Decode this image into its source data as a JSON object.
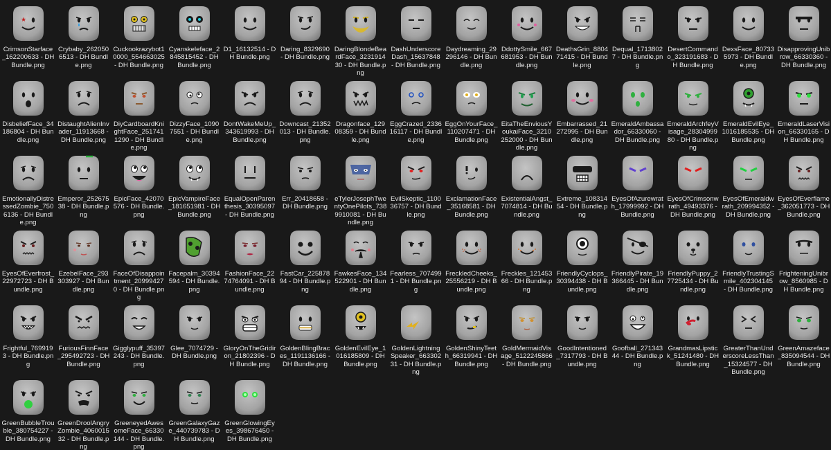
{
  "files": [
    {
      "name": "CrimsonStarface_162200633 - DH Bundle.png",
      "face": "starface"
    },
    {
      "name": "Crybaby_2620506513 - DH Bundle.png",
      "face": "crybaby"
    },
    {
      "name": "Cuckookrazybot10000_554663025 - DH Bundle.png",
      "face": "robot"
    },
    {
      "name": "Cyanskeleface_2845815452 - DH Bundle.png",
      "face": "skeleton"
    },
    {
      "name": "D1_16132514 - DH Bundle.png",
      "face": "smile"
    },
    {
      "name": "Daring_8329690 - DH Bundle.png",
      "face": "smirk"
    },
    {
      "name": "DaringBlondeBeardFace_323191430 - DH Bundle.png",
      "face": "beard"
    },
    {
      "name": "DashUnderscoreDash_15637848 - DH Bundle.png",
      "face": "dash"
    },
    {
      "name": "Daydreaming_29296146 - DH Bundle.png",
      "face": "daydream"
    },
    {
      "name": "DdottySmile_667681953 - DH Bundle.png",
      "face": "dotty"
    },
    {
      "name": "DeathsGrin_880471415 - DH Bundle.png",
      "face": "grin"
    },
    {
      "name": "Dequal_17138027 - DH Bundle.png",
      "face": "dequal"
    },
    {
      "name": "DesertCommando_323191683 - DH Bundle.png",
      "face": "commando"
    },
    {
      "name": "DexsFace_807335973 - DH Bundle.png",
      "face": "smile"
    },
    {
      "name": "DisapprovingUnibrow_66330360 - DH Bundle.png",
      "face": "unibrow"
    },
    {
      "name": "DisbeliefFace_34186804 - DH Bundle.png",
      "face": "shock"
    },
    {
      "name": "DistaughtAlienInvader_11913668 - DH Bundle.png",
      "face": "frown"
    },
    {
      "name": "DiyCardboardKnightFace_2517411290 - DH Bundle.png",
      "face": "knight"
    },
    {
      "name": "DizzyFace_10907551 - DH Bundle.png",
      "face": "dizzy"
    },
    {
      "name": "DontWakeMeUp_343619993 - DH Bundle.png",
      "face": "angry"
    },
    {
      "name": "Downcast_21352013 - DH Bundle.png",
      "face": "frown"
    },
    {
      "name": "Dragonface_12908359 - DH Bundle.png",
      "face": "dragon"
    },
    {
      "name": "EggCrazed_233616117 - DH Bundle.png",
      "face": "crazed"
    },
    {
      "name": "EggOnYourFace_110207471 - DH Bundle.png",
      "face": "egg"
    },
    {
      "name": "EitaTheEnviousYoukaiFace_3210252000 - DH Bundle.png",
      "face": "youkai"
    },
    {
      "name": "Embarrassed_21272995 - DH Bundle.png",
      "face": "blush"
    },
    {
      "name": "EmeraldAmbassador_66330060 - DH Bundle.png",
      "face": "emerald"
    },
    {
      "name": "EmeraldArchfeyVisage_2830499980 - DH Bundle.png",
      "face": "archfey"
    },
    {
      "name": "EmeraldEvilEye_1016185535 - DH Bundle.png",
      "face": "evileye"
    },
    {
      "name": "EmeraldLaserVision_66330165 - DH Bundle.png",
      "face": "laser"
    },
    {
      "name": "EmotionallyDistressedZombie_7506136 - DH Bundle.png",
      "face": "frown"
    },
    {
      "name": "Emperor_25267538 - DH Bundle.png",
      "face": "emperor"
    },
    {
      "name": "EpicFace_42070576 - DH Bundle.png",
      "face": "epic"
    },
    {
      "name": "EpicVampireFace_181651981 - DH Bundle.png",
      "face": "epicvamp"
    },
    {
      "name": "EqualOpenParenthesis_30395097 - DH Bundle.png",
      "face": "equal"
    },
    {
      "name": "Err_20418658 - DH Bundle.png",
      "face": "err"
    },
    {
      "name": "eTylerJosephTwentyOnePilots_7389910081 - DH Bundle.png",
      "face": "tyler"
    },
    {
      "name": "EvilSkeptic_110036757 - DH Bundle.png",
      "face": "evilred"
    },
    {
      "name": "ExclamationFace_35168581 - DH Bundle.png",
      "face": "exclaim"
    },
    {
      "name": "ExistentialAngst_7074814 - DH Bundle.png",
      "face": "angst"
    },
    {
      "name": "Extreme_10831454 - DH Bundle.png",
      "face": "extreme"
    },
    {
      "name": "EyesOfAzurewrath_17999992 - DH Bundle.png",
      "face": "eyespurple"
    },
    {
      "name": "EyesOfCrimsonwrath_49493376 - DH Bundle.png",
      "face": "eyesred"
    },
    {
      "name": "EyesOfEmeraldwrath_209994352 - DH Bundle.png",
      "face": "eyesgreen"
    },
    {
      "name": "EyesOfEverflame_362051773 - DH Bundle.png",
      "face": "everflame"
    },
    {
      "name": "EyesOfEverfrost_22972723 - DH Bundle.png",
      "face": "everflame"
    },
    {
      "name": "EzebelFace_293303927 - DH Bundle.png",
      "face": "ezebel"
    },
    {
      "name": "FaceOfDisappointment_209994270 - DH Bundle.png",
      "face": "frown"
    },
    {
      "name": "Facepalm_30394594 - DH Bundle.png",
      "face": "facepalm"
    },
    {
      "name": "FashionFace_2274764091 - DH Bundle.png",
      "face": "fashion"
    },
    {
      "name": "FastCar_22587894 - DH Bundle.png",
      "face": "fastcar"
    },
    {
      "name": "FawkesFace_134522901 - DH Bundle.png",
      "face": "fawkes"
    },
    {
      "name": "Fearless_7074991 - DH Bundle.png",
      "face": "fearless"
    },
    {
      "name": "FreckledCheeks_25556219 - DH Bundle.png",
      "face": "freckled"
    },
    {
      "name": "Freckles_12145366 - DH Bundle.png",
      "face": "freckles"
    },
    {
      "name": "FriendlyCyclops_30394438 - DH Bundle.png",
      "face": "cyclops"
    },
    {
      "name": "FriendlyPirate_19366445 - DH Bundle.png",
      "face": "pirate"
    },
    {
      "name": "FriendlyPuppy_27725434 - DH Bundle.png",
      "face": "puppy"
    },
    {
      "name": "FriendlyTrustingSmile_402304145 - DH Bundle.png",
      "face": "trusting"
    },
    {
      "name": "FrighteningUnibrow_8560985 - DH Bundle.png",
      "face": "frightunibrow"
    },
    {
      "name": "Frightful_7699193 - DH Bundle.png",
      "face": "frightful"
    },
    {
      "name": "FuriousFinnFace_295492723 - DH Bundle.png",
      "face": "furious"
    },
    {
      "name": "Gigglypuff_35397243 - DH Bundle.png",
      "face": "giggly"
    },
    {
      "name": "Glee_7074729 - DH Bundle.png",
      "face": "glee"
    },
    {
      "name": "GloryOnTheGridiron_21802396 - DH Bundle.png",
      "face": "glory"
    },
    {
      "name": "GoldenBlingBraces_1191136166 - DH Bundle.png",
      "face": "braces"
    },
    {
      "name": "GoldenEvilEye_1016185809 - DH Bundle.png",
      "face": "goldeye"
    },
    {
      "name": "GoldenLightningSpeaker_66330231 - DH Bundle.png",
      "face": "lightning"
    },
    {
      "name": "GoldenShinyTeeth_66319941 - DH Bundle.png",
      "face": "shinyteeth"
    },
    {
      "name": "GoldMermaidVisage_5122245866 - DH Bundle.png",
      "face": "mermaid"
    },
    {
      "name": "GoodIntentioned_7317793 - DH Bundle.png",
      "face": "goodint"
    },
    {
      "name": "Goofball_27134344 - DH Bundle.png",
      "face": "goofball"
    },
    {
      "name": "GrandmasLipstick_51241480 - DH Bundle.png",
      "face": "lipstick"
    },
    {
      "name": "GreaterThanUnderscoreLessThan_15324577 - DH Bundle.png",
      "face": "gtlt"
    },
    {
      "name": "GreenAmazeface_835094544 - DH Bundle.png",
      "face": "amaze"
    },
    {
      "name": "GreenBubbleTrouble_380754227 - DH Bundle.png",
      "face": "bubble"
    },
    {
      "name": "GreenDroolAngryZombie_406001532 - DH Bundle.png",
      "face": "drool"
    },
    {
      "name": "GreeneyedAwesomeFace_66330144 - DH Bundle.png",
      "face": "awesome"
    },
    {
      "name": "GreenGalaxyGaze_440739783 - DH Bundle.png",
      "face": "galaxy"
    },
    {
      "name": "GreenGlowingEyes_398676450 - DH Bundle.png",
      "face": "glowing"
    }
  ],
  "colors": {
    "background": "#191919",
    "head": "#a3a3a3",
    "head_dark": "#7c7c7c",
    "label": "#e8e8e8"
  }
}
